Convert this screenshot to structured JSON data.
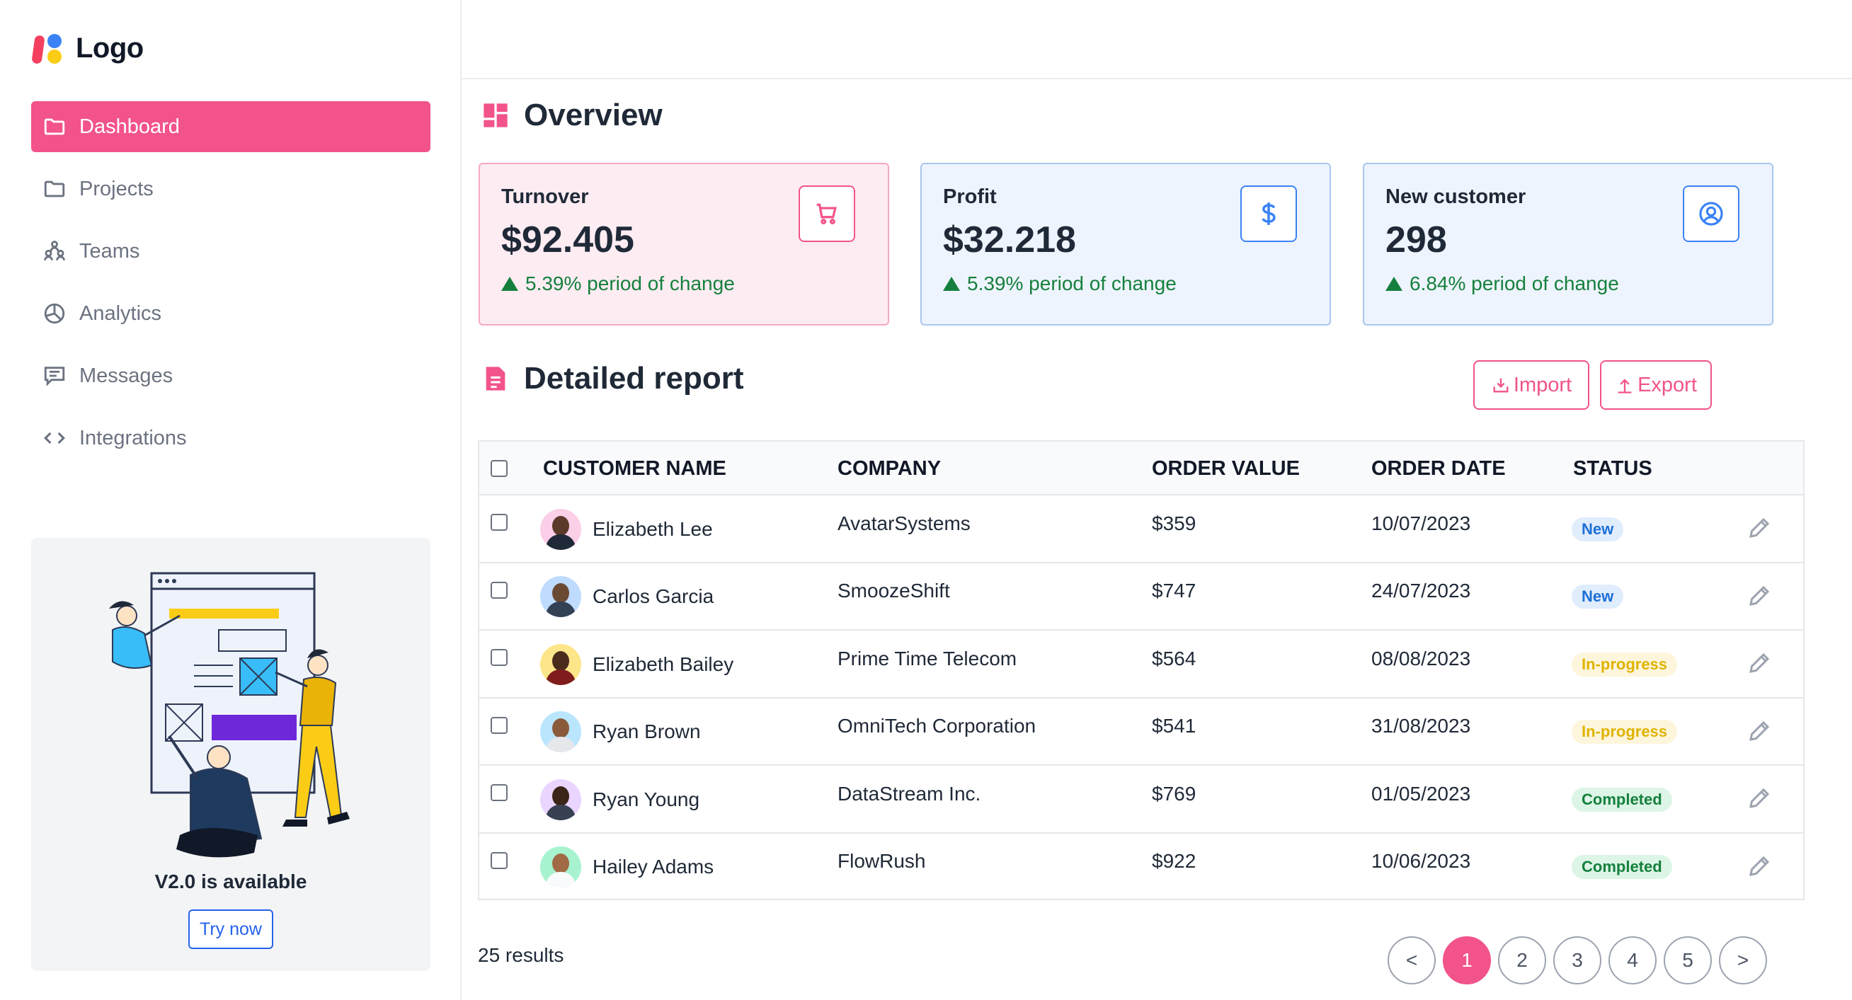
{
  "logo": {
    "text": "Logo"
  },
  "nav": [
    {
      "label": "Dashboard",
      "icon": "folder-icon",
      "active": true
    },
    {
      "label": "Projects",
      "icon": "folder-icon"
    },
    {
      "label": "Teams",
      "icon": "teams-icon"
    },
    {
      "label": "Analytics",
      "icon": "pie-chart-icon"
    },
    {
      "label": "Messages",
      "icon": "message-icon"
    },
    {
      "label": "Integrations",
      "icon": "code-icon"
    }
  ],
  "promo": {
    "title": "V2.0 is available",
    "button": "Try now"
  },
  "overview": {
    "title": "Overview",
    "cards": [
      {
        "label": "Turnover",
        "value": "$92.405",
        "change": "5.39% period of change",
        "icon": "cart-icon",
        "bg": "#fdecf2",
        "accent": "#f2538b"
      },
      {
        "label": "Profit",
        "value": "$32.218",
        "change": "5.39% period of change",
        "icon": "dollar-icon",
        "bg": "#eef4fd",
        "accent": "#3b82f6"
      },
      {
        "label": "New customer",
        "value": "298",
        "change": "6.84% period of change",
        "icon": "user-circle-icon",
        "bg": "#eef4fd",
        "accent": "#3b82f6"
      }
    ]
  },
  "report": {
    "title": "Detailed report",
    "import_label": "Import",
    "export_label": "Export",
    "columns": [
      "CUSTOMER NAME",
      "COMPANY",
      "ORDER VALUE",
      "ORDER DATE",
      "STATUS"
    ],
    "rows": [
      {
        "name": "Elizabeth Lee",
        "company": "AvatarSystems",
        "value": "$359",
        "date": "10/07/2023",
        "status": "New"
      },
      {
        "name": "Carlos Garcia",
        "company": "SmoozeShift",
        "value": "$747",
        "date": "24/07/2023",
        "status": "New"
      },
      {
        "name": "Elizabeth Bailey",
        "company": "Prime Time Telecom",
        "value": "$564",
        "date": "08/08/2023",
        "status": "In-progress"
      },
      {
        "name": "Ryan Brown",
        "company": "OmniTech Corporation",
        "value": "$541",
        "date": "31/08/2023",
        "status": "In-progress"
      },
      {
        "name": "Ryan Young",
        "company": "DataStream Inc.",
        "value": "$769",
        "date": "01/05/2023",
        "status": "Completed"
      },
      {
        "name": "Hailey Adams",
        "company": "FlowRush",
        "value": "$922",
        "date": "10/06/2023",
        "status": "Completed"
      }
    ],
    "status_colors": {
      "New": {
        "bg": "#e0edfd",
        "fg": "#1d6fd6"
      },
      "In-progress": {
        "bg": "#fdf6dc",
        "fg": "#e0b300"
      },
      "Completed": {
        "bg": "#dcf5e6",
        "fg": "#15803d"
      }
    }
  },
  "results_text": "25 results",
  "pagination": {
    "prev": "<",
    "pages": [
      "1",
      "2",
      "3",
      "4",
      "5"
    ],
    "next": ">",
    "current": "1"
  }
}
